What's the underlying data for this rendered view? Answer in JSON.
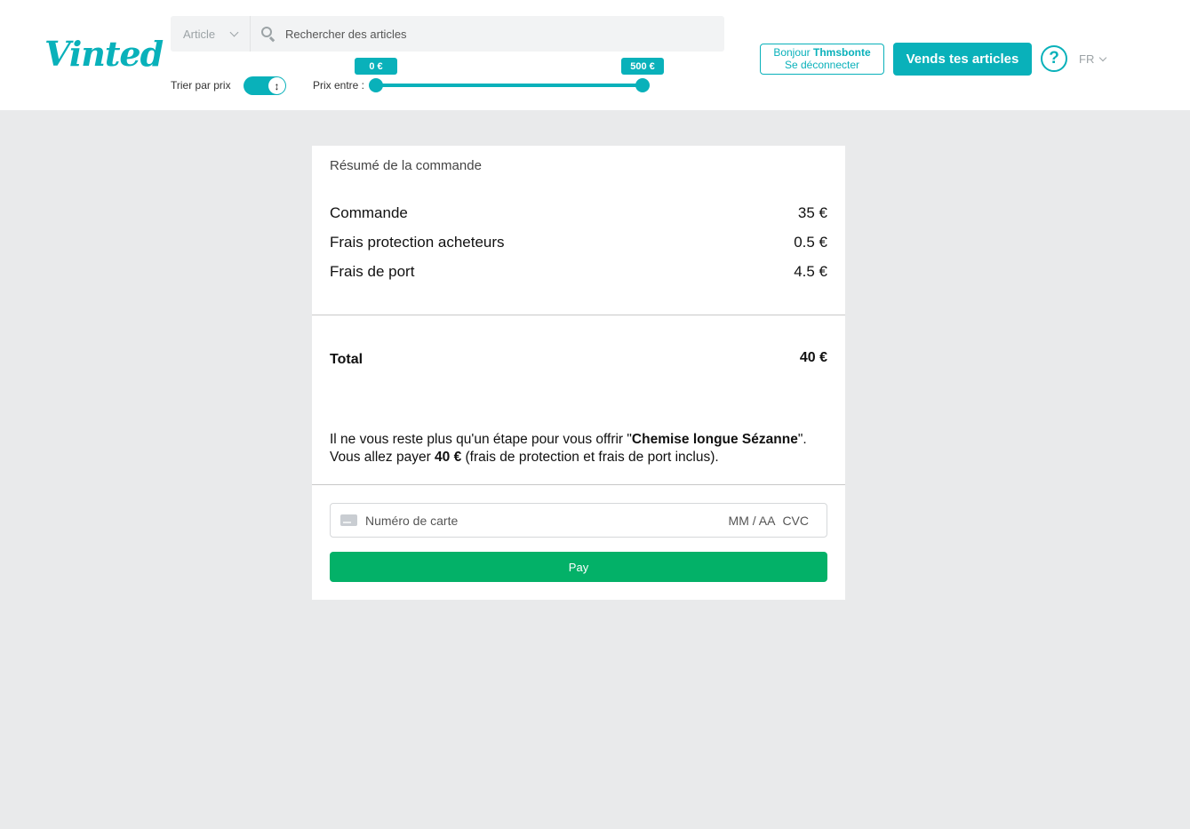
{
  "header": {
    "logo": "Vinted",
    "category_select": "Article",
    "search_placeholder": "Rechercher des articles",
    "sort_label": "Trier par prix",
    "price_label": "Prix entre :",
    "price_min": "0 €",
    "price_max": "500 €",
    "greeting_prefix": "Bonjour ",
    "username": "Thmsbonte",
    "logout": "Se déconnecter",
    "sell_button": "Vends tes articles",
    "help": "?",
    "language": "FR",
    "accent_color": "#09b1ba"
  },
  "summary": {
    "title": "Résumé de la commande",
    "lines": [
      {
        "label": "Commande",
        "value": "35 €"
      },
      {
        "label": "Frais protection acheteurs",
        "value": "0.5 €"
      },
      {
        "label": "Frais de port",
        "value": "4.5 €"
      }
    ],
    "total_label": "Total",
    "total_value": "40 €",
    "message": {
      "part1": "Il ne vous reste plus qu'un étape pour vous offrir \"",
      "item": "Chemise longue Sézanne",
      "part2": "\".",
      "part3": "Vous allez payer ",
      "amount": "40 €",
      "part4": " (frais de protection et frais de port inclus)."
    }
  },
  "payment": {
    "card_placeholder": "Numéro de carte",
    "expiry_placeholder": "MM / AA",
    "cvc_placeholder": "CVC",
    "pay_button": "Pay",
    "pay_color": "#03b168"
  }
}
